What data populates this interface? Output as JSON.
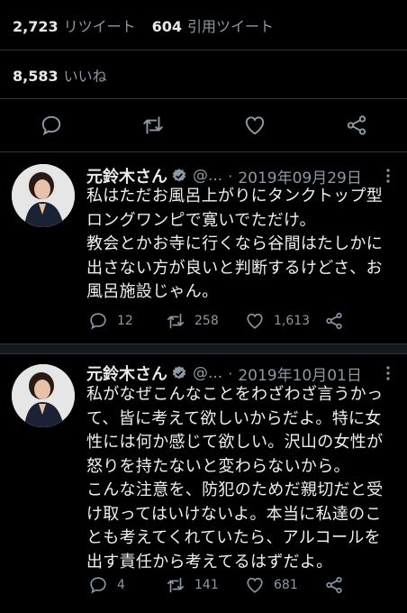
{
  "stats": {
    "retweets_num": "2,723",
    "retweets_label": "リツイート",
    "quotes_num": "604",
    "quotes_label": "引用ツイート",
    "likes_num": "8,583",
    "likes_label": "いいね"
  },
  "colors": {
    "background": "#000000",
    "text": "#e7e9ea",
    "muted": "#8b98a5",
    "verified": "#8b98a5",
    "divider": "#2f3336"
  },
  "tweets": [
    {
      "name": "元鈴木さん",
      "handle": "@...",
      "dot": "·",
      "date": "2019年09月29日",
      "text": "私はただお風呂上がりにタンクトップ型\nロングワンピで寛いでただけ。\n教会とかお寺に行くなら谷間はたしかに\n出さない方が良いと判断するけどさ、お\n風呂施設じゃん。",
      "replies": "12",
      "retweets": "258",
      "likes": "1,613"
    },
    {
      "name": "元鈴木さん",
      "handle": "@...",
      "dot": "·",
      "date": "2019年10月01日",
      "text": "私がなぜこんなことをわざわざ言うかっ\nて、皆に考えて欲しいからだよ。特に女\n性には何か感じて欲しい。沢山の女性が\n怒りを持たないと変わらないから。\nこんな注意を、防犯のためだ親切だと受\nけ取ってはいけないよ。本当に私達のこ\nとも考えてくれていたら、アルコールを\n出す責任から考えてるはずだよ。",
      "replies": "4",
      "retweets": "141",
      "likes": "681"
    }
  ],
  "icons": [
    "reply-icon",
    "retweet-icon",
    "like-icon",
    "share-icon",
    "verified-badge-icon",
    "more-icon"
  ]
}
